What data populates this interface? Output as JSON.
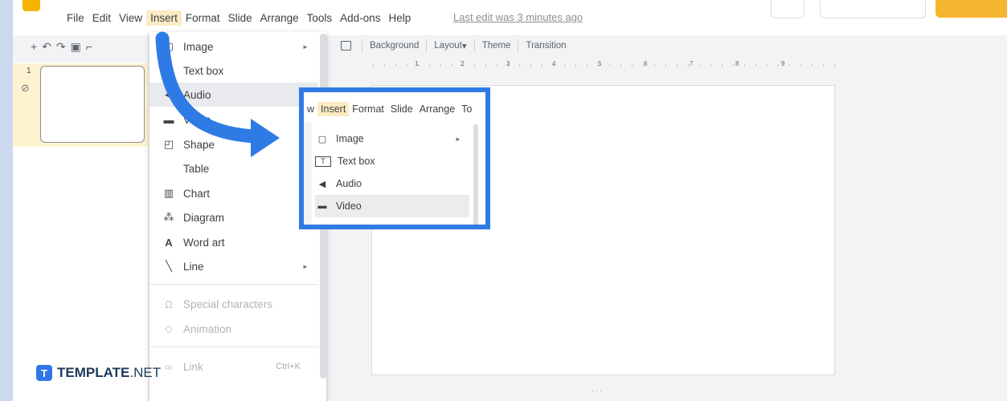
{
  "menubar": {
    "items": [
      "File",
      "Edit",
      "View",
      "Insert",
      "Format",
      "Slide",
      "Arrange",
      "Tools",
      "Add-ons",
      "Help"
    ],
    "active": "Insert",
    "last_edit": "Last edit was 3 minutes ago"
  },
  "toolbar": {
    "background": "Background",
    "layout": "Layout",
    "theme": "Theme",
    "transition": "Transition"
  },
  "ruler_numbers": [
    "1",
    "2",
    "3",
    "4",
    "5",
    "6",
    "7",
    "8",
    "9"
  ],
  "filmstrip": {
    "slide_number": "1"
  },
  "insert_menu": {
    "items": [
      {
        "icon": "image-icon",
        "label": "Image",
        "submenu": true
      },
      {
        "icon": "textbox-icon",
        "label": "Text box"
      },
      {
        "icon": "audio-icon",
        "label": "Audio",
        "hover": true
      },
      {
        "icon": "video-icon",
        "label": "Video"
      },
      {
        "icon": "shape-icon",
        "label": "Shape",
        "submenu": true
      },
      {
        "icon": "",
        "label": "Table",
        "submenu": true
      },
      {
        "icon": "chart-icon",
        "label": "Chart",
        "submenu": true
      },
      {
        "icon": "diagram-icon",
        "label": "Diagram"
      },
      {
        "icon": "word-art-icon",
        "label": "Word art"
      },
      {
        "icon": "line-icon",
        "label": "Line",
        "submenu": true
      },
      {
        "icon": "special-chars-icon",
        "label": "Special characters",
        "disabled": true
      },
      {
        "icon": "animation-icon",
        "label": "Animation",
        "disabled": true
      },
      {
        "icon": "link-icon",
        "label": "Link",
        "shortcut": "Ctrl+K",
        "disabled": true
      }
    ]
  },
  "zoom_callout": {
    "menubar": [
      "w",
      "Insert",
      "Format",
      "Slide",
      "Arrange",
      "To"
    ],
    "items": [
      {
        "icon": "image-icon",
        "label": "Image",
        "submenu": true
      },
      {
        "icon": "textbox-icon",
        "label": "Text box"
      },
      {
        "icon": "audio-icon",
        "label": "Audio"
      },
      {
        "icon": "video-icon",
        "label": "Video",
        "hover": true
      }
    ],
    "border_color": "#2f7be6"
  },
  "brand": {
    "name": "TEMPLATE",
    "suffix": ".NET"
  },
  "colors": {
    "accent": "#2f7be6",
    "menu_active": "#fcebc3",
    "logo": "#f4b400"
  }
}
